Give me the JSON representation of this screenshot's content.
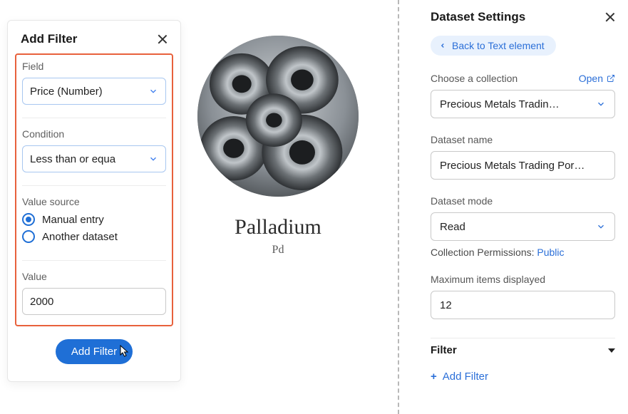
{
  "addFilter": {
    "title": "Add Filter",
    "fieldLabel": "Field",
    "fieldValue": "Price (Number)",
    "conditionLabel": "Condition",
    "conditionValue": "Less than or equa",
    "valueSourceLabel": "Value source",
    "radioManual": "Manual entry",
    "radioAnother": "Another dataset",
    "valueLabel": "Value",
    "valueValue": "2000",
    "submit": "Add Filter"
  },
  "center": {
    "title": "Palladium",
    "symbol": "Pd"
  },
  "settings": {
    "title": "Dataset Settings",
    "back": "Back to Text element",
    "collectionLabel": "Choose a collection",
    "openLabel": "Open",
    "collectionValue": "Precious Metals Tradin…",
    "datasetNameLabel": "Dataset name",
    "datasetNameValue": "Precious Metals Trading Por…",
    "modeLabel": "Dataset mode",
    "modeValue": "Read",
    "permissionsPrefix": "Collection Permissions: ",
    "permissionsValue": "Public",
    "maxItemsLabel": "Maximum items displayed",
    "maxItemsValue": "12",
    "filterHeader": "Filter",
    "addFilterLink": "Add Filter"
  }
}
